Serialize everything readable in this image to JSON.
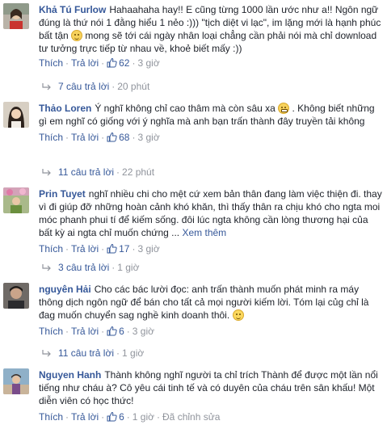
{
  "comments": [
    {
      "author": "Khả Tú Furlow",
      "text_before_emoji": "Hahaahaha hay!! E cũng từng 1000 lần ước như a!! Ngôn ngữ đúng là thứ nói 1 đằng hiểu 1 nẻo :))) \"tịch diệt vi lạc\", im lặng mới là hạnh phúc bất tận",
      "text_after_emoji": " mong sẽ tới cái ngày nhân loại chẳng cần phải nói mà chỉ download tư tưởng trực tiếp từ nhau về, khoẻ biết mấy :))",
      "more": "",
      "emoji": "smile-emoji-icon",
      "like_label": "Thích",
      "reply_label": "Trả lời",
      "like_count": "62",
      "time": "3 giờ",
      "replies_label": "7 câu trả lời",
      "replies_time": "20 phút"
    },
    {
      "author": "Thảo Loren",
      "text_before_emoji": "Ý nghĩ không chỉ cao thâm mà còn sâu xa",
      "text_after_emoji": " . Không biết những gì em nghĩ có giống với ý nghĩa mà anh bạn trấn thành đây truyền tải không",
      "more": "",
      "emoji": "grin-emoji-icon",
      "like_label": "Thích",
      "reply_label": "Trả lời",
      "like_count": "68",
      "time": "3 giờ",
      "replies_label": "11 câu trả lời",
      "replies_time": "22 phút"
    },
    {
      "author": "Prin Tuyet",
      "text_before_emoji": "nghĩ nhiều chi cho mệt cứ xem bản thân đang làm việc thiện đi. thay vì đi giúp đỡ những hoàn cảnh khó khăn, thì thấy thân ra chịu khó cho ngta moi móc phanh phui tí để kiếm sống. đôi lúc ngta không cần lòng thương hại của bất kỳ ai ngta chỉ muốn chứng ...",
      "text_after_emoji": "",
      "more": "Xem thêm",
      "emoji": "",
      "like_label": "Thích",
      "reply_label": "Trả lời",
      "like_count": "17",
      "time": "3 giờ",
      "replies_label": "3 câu trả lời",
      "replies_time": "1 giờ"
    },
    {
      "author": "nguyên Hải",
      "text_before_emoji": "Cho các bác lười đọc: anh trấn thành muốn phát minh ra máy thông dịch ngôn ngữ để bán cho tất cả mọi người kiếm lời. Tóm lại củg chỉ là đag muốn chuyển sag nghề kinh doanh thôi.",
      "text_after_emoji": "",
      "more": "",
      "emoji": "wink-emoji-icon",
      "like_label": "Thích",
      "reply_label": "Trả lời",
      "like_count": "6",
      "time": "3 giờ",
      "replies_label": "11 câu trả lời",
      "replies_time": "1 giờ"
    },
    {
      "author": "Nguyen Hanh",
      "text_before_emoji": "Thành không nghĩ người ta chỉ trích Thành để được một lần nổi tiếng như cháu à? Cô yêu cái tinh tế và có duyên của cháu trên sân khấu! Một diễn viên có học thức!",
      "text_after_emoji": "",
      "more": "",
      "emoji": "",
      "like_label": "Thích",
      "reply_label": "Trả lời",
      "like_count": "6",
      "time": "1 giờ",
      "edited_label": "Đã chỉnh sửa"
    }
  ]
}
